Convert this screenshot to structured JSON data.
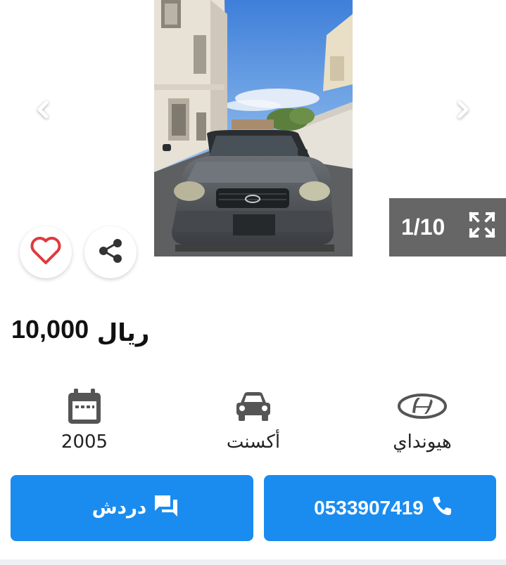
{
  "gallery": {
    "counter": "1/10",
    "prev_icon": "chevron-left-icon",
    "next_icon": "chevron-right-icon",
    "expand_icon": "fullscreen-icon",
    "brand_logo": "Hyundai"
  },
  "actions": {
    "favorite_icon": "heart-outline-icon",
    "favorite_color": "#e0393e",
    "share_icon": "share-icon"
  },
  "listing": {
    "price": "10,000",
    "currency": "ريال"
  },
  "specs": {
    "make": "هيونداي",
    "make_icon": "hyundai-logo-icon",
    "model": "أكسنت",
    "model_icon": "car-icon",
    "year": "2005",
    "year_icon": "calendar-icon"
  },
  "buttons": {
    "chat_label": "دردش",
    "chat_icon": "chat-icon",
    "phone_label": "0533907419",
    "phone_icon": "phone-icon",
    "accent": "#1a8cf0"
  }
}
